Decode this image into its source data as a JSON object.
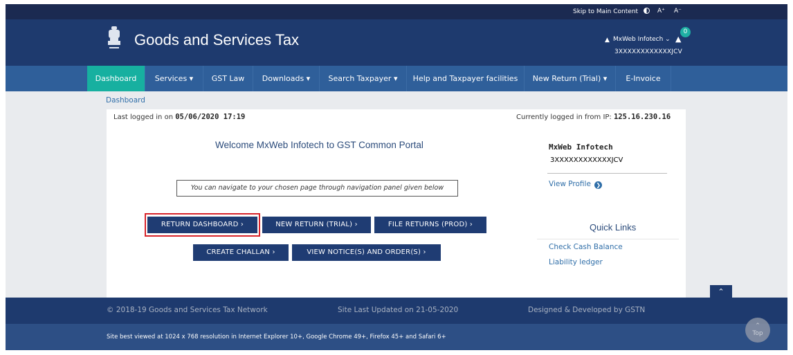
{
  "utility_bar": {
    "skip_link": "Skip to Main Content",
    "font_increase": "A⁺",
    "font_decrease": "A⁻"
  },
  "header": {
    "title": "Goods and Services Tax",
    "user_name": "MxWeb Infotech ⌄",
    "notification_count": "0",
    "gstin": "3XXXXXXXXXXXXJCV"
  },
  "nav": {
    "items": [
      {
        "label": "Dashboard",
        "active": true
      },
      {
        "label": "Services ▾"
      },
      {
        "label": "GST Law"
      },
      {
        "label": "Downloads ▾"
      },
      {
        "label": "Search Taxpayer ▾"
      },
      {
        "label": "Help and Taxpayer facilities"
      },
      {
        "label": "New Return (Trial) ▾"
      },
      {
        "label": "E-Invoice"
      }
    ]
  },
  "breadcrumb": "Dashboard",
  "session": {
    "last_login_label": "Last logged in on ",
    "last_login_value": "05/06/2020 17:19",
    "ip_label": "Currently logged in from IP: ",
    "ip_value": "125.16.230.16"
  },
  "main": {
    "welcome": "Welcome MxWeb Infotech to GST Common Portal",
    "hint": "You can navigate to your chosen page through navigation panel given below",
    "buttons": [
      {
        "label": "RETURN DASHBOARD ›",
        "highlighted": true
      },
      {
        "label": "NEW RETURN (TRIAL) ›"
      },
      {
        "label": "FILE RETURNS (PROD) ›"
      },
      {
        "label": "CREATE CHALLAN ›"
      },
      {
        "label": "VIEW NOTICE(S) AND ORDER(S) ›"
      }
    ]
  },
  "profile": {
    "name": "MxWeb Infotech",
    "gstin": "3XXXXXXXXXXXXJCV",
    "view_profile": "View Profile"
  },
  "quick_links": {
    "title": "Quick Links",
    "items": [
      "Check Cash Balance",
      "Liability ledger"
    ]
  },
  "footer": {
    "copyright": "© 2018-19 Goods and Services Tax Network",
    "updated": "Site Last Updated on 21-05-2020",
    "designed": "Designed & Developed by GSTN",
    "best_viewed": "Site best viewed at 1024 x 768 resolution in Internet Explorer 10+, Google Chrome 49+, Firefox 45+ and Safari 6+",
    "top_label": "Top"
  },
  "colors": {
    "header_bg": "#1e3a6e",
    "nav_bg": "#2f5f9a",
    "nav_active": "#17b0a0",
    "button_bg": "#1f3c73",
    "highlight_border": "#d8232a",
    "link": "#2f6ea8"
  },
  "icons": {
    "emblem": "national-emblem-icon",
    "user": "user-icon",
    "bell": "bell-icon",
    "contrast": "contrast-icon",
    "arrow": "arrow-right-circle-icon",
    "chevron_up": "chevron-up-icon"
  }
}
